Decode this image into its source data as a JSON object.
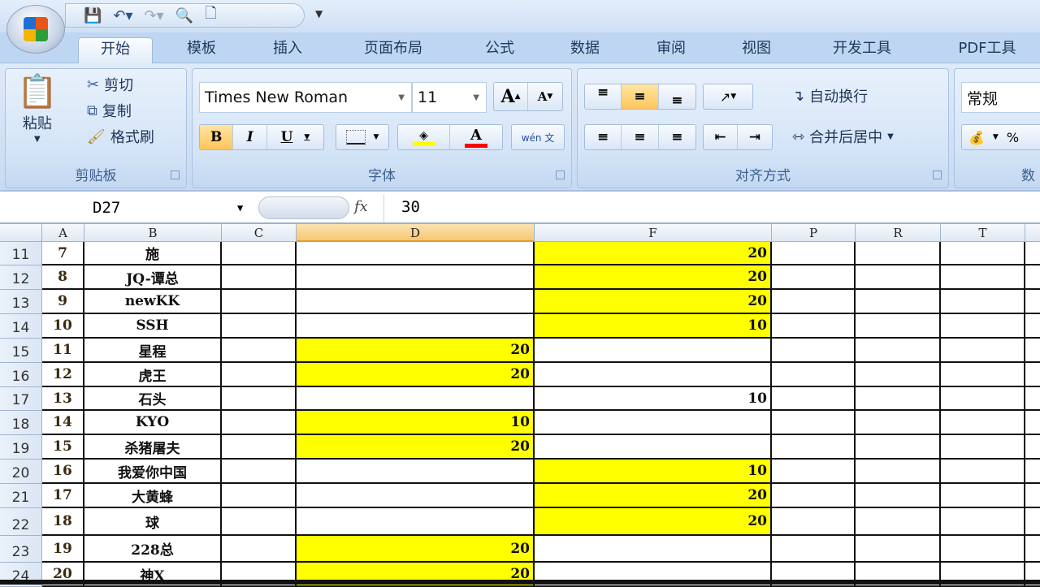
{
  "qat": {
    "icons": [
      "save-icon",
      "undo-icon",
      "redo-icon",
      "print-preview-icon",
      "new-document-icon"
    ]
  },
  "tabs": [
    "开始",
    "模板",
    "插入",
    "页面布局",
    "公式",
    "数据",
    "审阅",
    "视图",
    "开发工具",
    "PDF工具"
  ],
  "active_tab": "开始",
  "clipboard": {
    "paste": "粘贴",
    "cut": "剪切",
    "copy": "复制",
    "format_painter": "格式刷",
    "label": "剪贴板"
  },
  "font": {
    "name": "Times New Roman",
    "size": "11",
    "label": "字体",
    "bold": "B",
    "italic": "I",
    "underline": "U",
    "grow": "A",
    "shrink": "A",
    "fill_color": "#ffff00",
    "font_color": "#ff0000",
    "phonetic": "wén 文"
  },
  "alignment": {
    "wrap": "自动换行",
    "merge": "合并后居中",
    "label": "对齐方式"
  },
  "number": {
    "format": "常规",
    "percent": "%",
    "label": "数"
  },
  "formula_bar": {
    "name_box": "D27",
    "fx": "fx",
    "value": "30"
  },
  "columns": [
    "A",
    "B",
    "C",
    "D",
    "F",
    "P",
    "R",
    "T"
  ],
  "selected_column": "D",
  "highlight_color": "#ffff00",
  "rows": [
    {
      "num": "11",
      "a": "7",
      "b": "施",
      "d": "",
      "f": "20",
      "dy": false,
      "fy": true
    },
    {
      "num": "12",
      "a": "8",
      "b": "JQ-谭总",
      "d": "",
      "f": "20",
      "dy": false,
      "fy": true
    },
    {
      "num": "13",
      "a": "9",
      "b": "newKK",
      "d": "",
      "f": "20",
      "dy": false,
      "fy": true
    },
    {
      "num": "14",
      "a": "10",
      "b": "SSH",
      "d": "",
      "f": "10",
      "dy": false,
      "fy": true
    },
    {
      "num": "15",
      "a": "11",
      "b": "星程",
      "d": "20",
      "f": "",
      "dy": true,
      "fy": false
    },
    {
      "num": "16",
      "a": "12",
      "b": "虎王",
      "d": "20",
      "f": "",
      "dy": true,
      "fy": false
    },
    {
      "num": "17",
      "a": "13",
      "b": "石头",
      "d": "",
      "f": "10",
      "dy": false,
      "fy": false
    },
    {
      "num": "18",
      "a": "14",
      "b": "KYO",
      "d": "10",
      "f": "",
      "dy": true,
      "fy": false
    },
    {
      "num": "19",
      "a": "15",
      "b": "杀猪屠夫",
      "d": "20",
      "f": "",
      "dy": true,
      "fy": false
    },
    {
      "num": "20",
      "a": "16",
      "b": "我爱你中国",
      "d": "",
      "f": "10",
      "dy": false,
      "fy": true
    },
    {
      "num": "21",
      "a": "17",
      "b": "大黄蜂",
      "d": "",
      "f": "20",
      "dy": false,
      "fy": true
    },
    {
      "num": "22",
      "a": "18",
      "b": "球",
      "d": "",
      "f": "20",
      "dy": false,
      "fy": true
    },
    {
      "num": "23",
      "a": "19",
      "b": "228总",
      "d": "20",
      "f": "",
      "dy": true,
      "fy": false
    },
    {
      "num": "24",
      "a": "20",
      "b": "神X",
      "d": "20",
      "f": "",
      "dy": true,
      "fy": false
    }
  ]
}
